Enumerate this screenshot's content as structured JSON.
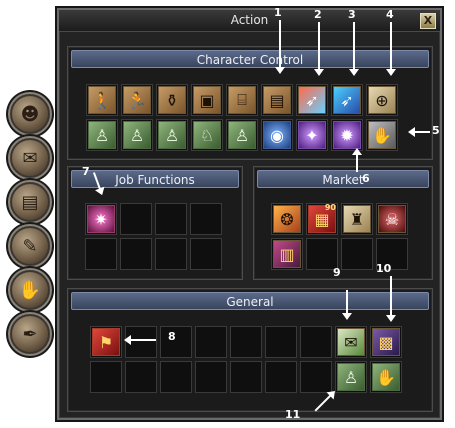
{
  "window": {
    "title": "Action",
    "close_label": "X"
  },
  "side_tabs": [
    "character-tab-icon",
    "inventory-tab-icon",
    "skills-tab-icon",
    "quest-tab-icon",
    "social-tab-icon",
    "map-tab-icon"
  ],
  "character_control": {
    "title": "Character Control",
    "row1": [
      "walk",
      "run",
      "sit",
      "chest",
      "fence",
      "map-scroll",
      "red-feather",
      "blue-feather",
      "paper-scroll"
    ],
    "row2": [
      "green-stance",
      "green-pose",
      "green-flex",
      "green-strike",
      "green-guard",
      "blue-orb",
      "purple-gem",
      "violet-gem",
      "ghost-hand"
    ]
  },
  "job_functions": {
    "title": "Job Functions",
    "slots": [
      "pink-burst"
    ]
  },
  "market": {
    "title": "Market",
    "slots": [
      "orange-token",
      "receipt",
      "bag",
      "red-skull",
      "book"
    ],
    "receipt_badge": "90"
  },
  "general": {
    "title": "General",
    "slots": [
      "red-banner",
      "green-scroll",
      "purple-box",
      "green-figure-1",
      "green-figure-2"
    ]
  },
  "annotations": {
    "n1": "1",
    "n2": "2",
    "n3": "3",
    "n4": "4",
    "n5": "5",
    "n6": "6",
    "n7": "7",
    "n8": "8",
    "n9": "9",
    "n10": "10",
    "n11": "11"
  }
}
